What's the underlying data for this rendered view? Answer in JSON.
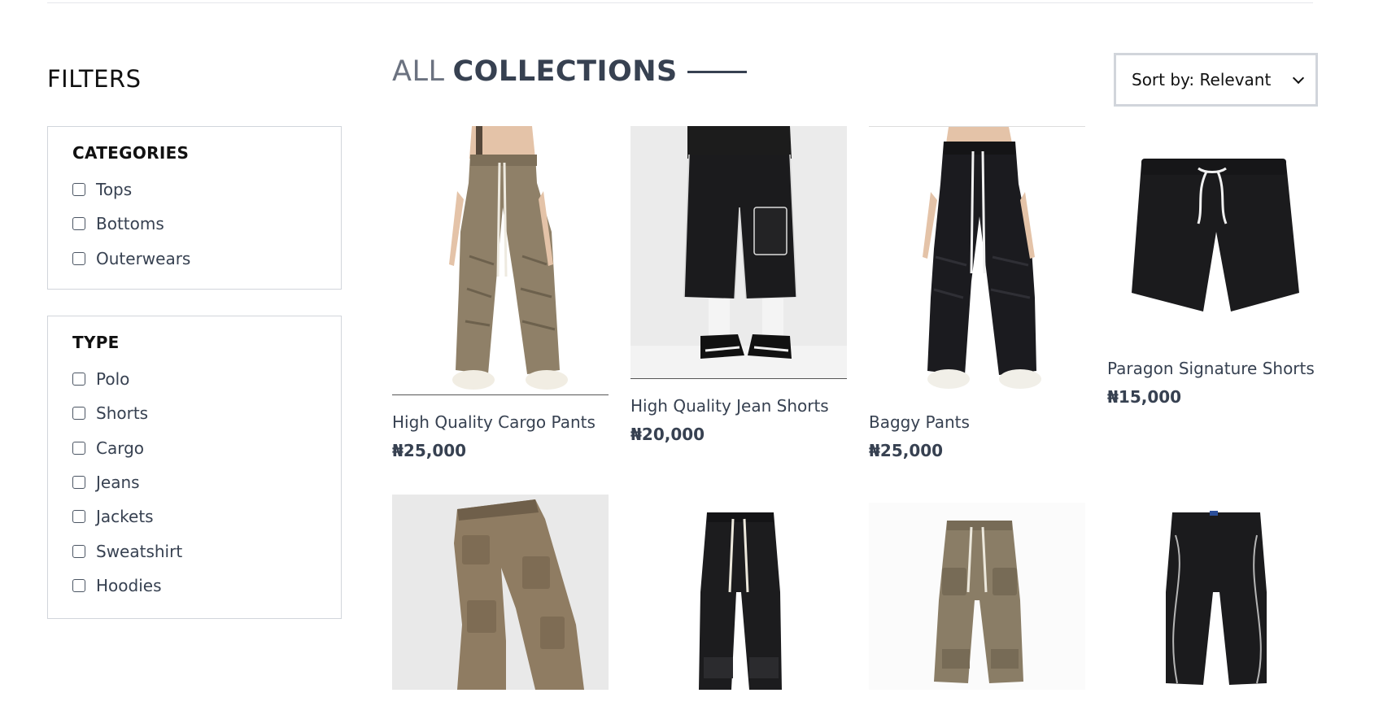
{
  "filters": {
    "title": "FILTERS",
    "categories": {
      "heading": "CATEGORIES",
      "options": [
        "Tops",
        "Bottoms",
        "Outerwears"
      ]
    },
    "type": {
      "heading": "TYPE",
      "options": [
        "Polo",
        "Shorts",
        "Cargo",
        "Jeans",
        "Jackets",
        "Sweatshirt",
        "Hoodies"
      ]
    }
  },
  "collections": {
    "title_prefix": "ALL",
    "title_main": "COLLECTIONS"
  },
  "sort": {
    "label": "Sort by: Relevant"
  },
  "products": [
    {
      "name": "High Quality Cargo Pants",
      "price": "₦25,000"
    },
    {
      "name": "High Quality Jean Shorts",
      "price": "₦20,000"
    },
    {
      "name": "Baggy Pants",
      "price": "₦25,000"
    },
    {
      "name": "Paragon Signature Shorts",
      "price": "₦15,000"
    },
    {
      "name": "",
      "price": ""
    },
    {
      "name": "",
      "price": ""
    },
    {
      "name": "",
      "price": ""
    },
    {
      "name": "",
      "price": ""
    }
  ],
  "colors": {
    "khaki": "#8f8068",
    "black": "#1b1b1d",
    "text": "#374151",
    "border": "#d1d5db"
  }
}
